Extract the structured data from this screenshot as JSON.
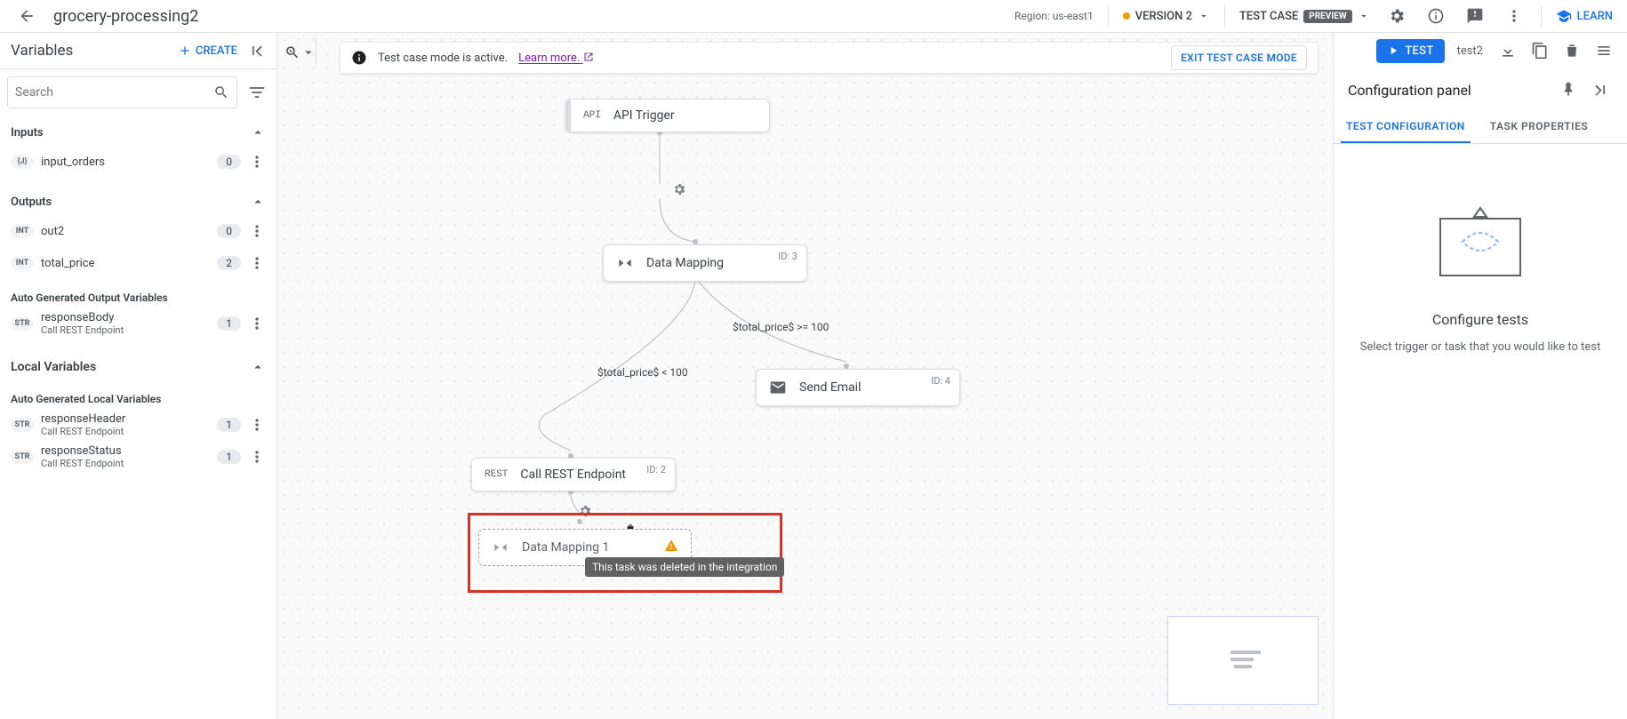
{
  "header": {
    "title": "grocery-processing2",
    "region": "Region: us-east1",
    "version": "VERSION 2",
    "testcase_label": "TEST CASE",
    "preview_badge": "PREVIEW",
    "learn": "LEARN"
  },
  "run_toolbar": {
    "test": "TEST",
    "test_name": "test2"
  },
  "variables_panel": {
    "title": "Variables",
    "create": "CREATE",
    "search_placeholder": "Search",
    "sections": {
      "inputs": "Inputs",
      "outputs": "Outputs",
      "local": "Local Variables",
      "auto_out": "Auto Generated Output Variables",
      "auto_local": "Auto Generated Local Variables"
    },
    "inputs": [
      {
        "type": "{J}",
        "name": "input_orders",
        "count": "0"
      }
    ],
    "outputs": [
      {
        "type": "INT",
        "name": "out2",
        "count": "0"
      },
      {
        "type": "INT",
        "name": "total_price",
        "count": "2"
      }
    ],
    "auto_out": [
      {
        "type": "STR",
        "name": "responseBody",
        "sub": "Call REST Endpoint",
        "count": "1"
      }
    ],
    "auto_local": [
      {
        "type": "STR",
        "name": "responseHeader",
        "sub": "Call REST Endpoint",
        "count": "1"
      },
      {
        "type": "STR",
        "name": "responseStatus",
        "sub": "Call REST Endpoint",
        "count": "1"
      }
    ]
  },
  "banner": {
    "msg": "Test case mode is active.",
    "link": "Learn more.",
    "exit": "EXIT TEST CASE MODE"
  },
  "canvas": {
    "nodes": {
      "trigger": {
        "icon": "API",
        "label": "API Trigger"
      },
      "map": {
        "label": "Data Mapping",
        "id": "ID: 3"
      },
      "email": {
        "label": "Send Email",
        "id": "ID: 4"
      },
      "rest": {
        "icon": "REST",
        "label": "Call REST Endpoint",
        "id": "ID: 2"
      },
      "map2": {
        "label": "Data Mapping 1"
      }
    },
    "edge_labels": {
      "lt": "$total_price$ < 100",
      "gte": "$total_price$ >= 100"
    },
    "tooltip": "This task was deleted in the integration"
  },
  "config": {
    "title": "Configuration panel",
    "tabs": {
      "test": "TEST CONFIGURATION",
      "task": "TASK PROPERTIES"
    },
    "empty_title": "Configure tests",
    "empty_sub": "Select trigger or task that you would like to test"
  }
}
